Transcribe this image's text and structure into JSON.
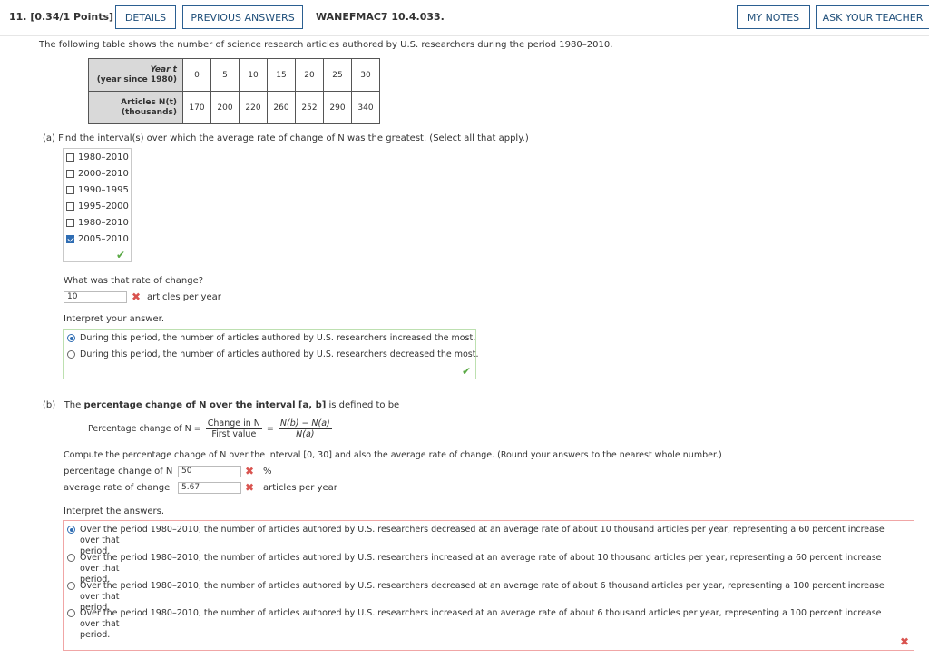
{
  "header": {
    "question_number": "11. [0.34/1 Points]",
    "details_label": "DETAILS",
    "previous_answers_label": "PREVIOUS ANSWERS",
    "question_code": "WANEFMAC7 10.4.033.",
    "my_notes_label": "MY NOTES",
    "ask_teacher_label": "ASK YOUR TEACHER"
  },
  "intro": "The following table shows the number of science research articles authored by U.S. researchers during the period 1980–2010.",
  "table": {
    "row1_header_line1": "Year t",
    "row1_header_line2": "(year since 1980)",
    "row2_header_line1": "Articles N(t)",
    "row2_header_line2": "(thousands)",
    "years": [
      "0",
      "5",
      "10",
      "15",
      "20",
      "25",
      "30"
    ],
    "articles": [
      "170",
      "200",
      "220",
      "260",
      "252",
      "290",
      "340"
    ]
  },
  "part_a": {
    "prompt": "(a)   Find the interval(s) over which the average rate of change of N was the greatest. (Select all that apply.)",
    "options": [
      {
        "label": "1980–2010",
        "checked": false
      },
      {
        "label": "2000–2010",
        "checked": false
      },
      {
        "label": "1990–1995",
        "checked": false
      },
      {
        "label": "1995–2000",
        "checked": false
      },
      {
        "label": "1980–2010",
        "checked": false
      },
      {
        "label": "2005–2010",
        "checked": true
      }
    ],
    "rate_question": "What was that rate of change?",
    "rate_value": "10",
    "rate_unit": "articles per year",
    "interpret_label": "Interpret your answer.",
    "interpret_options": [
      "During this period, the number of articles authored by U.S. researchers increased the most.",
      "During this period, the number of articles authored by U.S. researchers decreased the most."
    ]
  },
  "part_b": {
    "label": "(b)",
    "prompt_pre": "The ",
    "prompt_bold": "percentage change of N over the interval [a, b]",
    "prompt_post": " is defined to be",
    "formula_lhs": "Percentage change of N =",
    "frac1_num": "Change in N",
    "frac1_den": "First value",
    "frac2_num": "N(b) − N(a)",
    "frac2_den": "N(a)",
    "compute_text": "Compute the percentage change of N over the interval [0, 30] and also the average rate of change. (Round your answers to the nearest whole number.)",
    "pct_label": "percentage change of N",
    "pct_value": "50",
    "pct_unit": "%",
    "avg_label": "average rate of change",
    "avg_value": "5.67",
    "avg_unit": "articles per year",
    "interpret_label": "Interpret the answers.",
    "interpret_options": [
      {
        "line1": "Over the period 1980–2010, the number of articles authored by U.S. researchers decreased at an average rate of about 10 thousand articles per year, representing a 60 percent increase over that",
        "line2": "period."
      },
      {
        "line1": "Over the period 1980–2010, the number of articles authored by U.S. researchers increased at an average rate of about 10 thousand articles per year, representing a 60 percent increase over that",
        "line2": "period."
      },
      {
        "line1": "Over the period 1980–2010, the number of articles authored by U.S. researchers decreased at an average rate of about 6 thousand articles per year, representing a 100 percent increase over that",
        "line2": "period."
      },
      {
        "line1": "Over the period 1980–2010, the number of articles authored by U.S. researchers increased at an average rate of about 6 thousand articles per year, representing a 100 percent increase over that",
        "line2": "period."
      }
    ]
  }
}
